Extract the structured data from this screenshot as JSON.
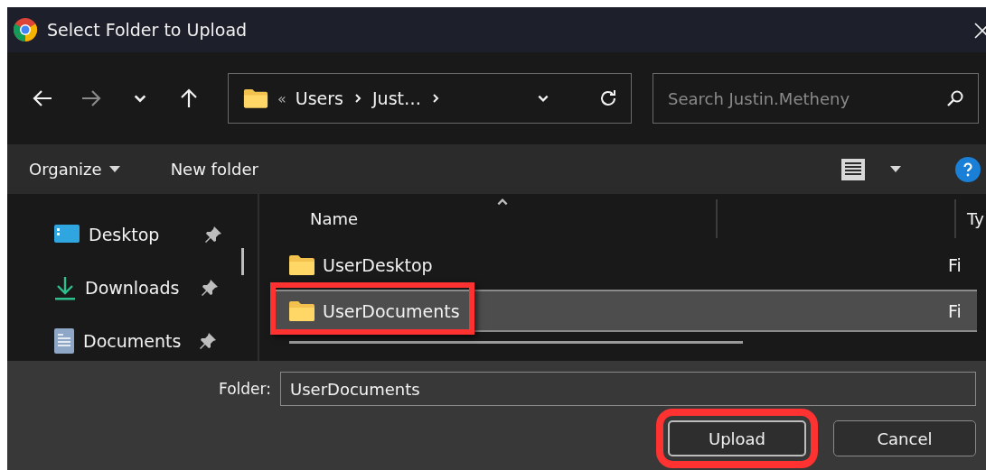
{
  "window": {
    "title": "Select Folder to Upload"
  },
  "nav_buttons": [
    {
      "kind": "back",
      "disabled": false
    },
    {
      "kind": "forward",
      "disabled": true
    },
    {
      "kind": "recent",
      "disabled": false
    },
    {
      "kind": "up",
      "disabled": false
    }
  ],
  "address": {
    "overflow": "«",
    "segments": [
      "Users",
      "Just…"
    ]
  },
  "search": {
    "placeholder": "Search Justin.Metheny"
  },
  "toolbar": {
    "organize": "Organize",
    "new_folder": "New folder"
  },
  "sidebar": {
    "items": [
      {
        "label": "Desktop",
        "kind": "desktop",
        "pinned": true
      },
      {
        "label": "Downloads",
        "kind": "downloads",
        "pinned": true
      },
      {
        "label": "Documents",
        "kind": "documents",
        "pinned": true
      }
    ]
  },
  "columns": [
    {
      "label": "Name"
    },
    {
      "label": "Ty"
    }
  ],
  "files": [
    {
      "name": "UserDesktop",
      "type": "Fi",
      "selected": false,
      "highlighted": false
    },
    {
      "name": "UserDocuments",
      "type": "Fi",
      "selected": true,
      "highlighted": true
    }
  ],
  "folder_field": {
    "label": "Folder:",
    "value": "UserDocuments"
  },
  "buttons": [
    {
      "label": "Upload",
      "highlighted": true
    },
    {
      "label": "Cancel",
      "highlighted": false
    }
  ]
}
